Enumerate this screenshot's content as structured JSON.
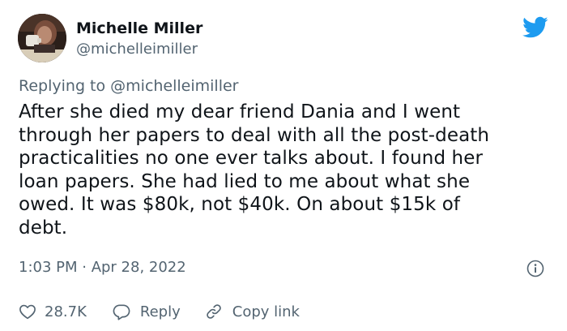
{
  "author": {
    "display_name": "Michelle Miller",
    "handle": "@michelleimiller"
  },
  "reply": {
    "prefix": "Replying to ",
    "mention": "@michelleimiller"
  },
  "tweet": {
    "lines": [
      "After she died my dear friend Dania and I went",
      "through her papers to deal with all the post-death",
      "practicalities no one ever talks about. I found her",
      "loan papers. She had lied to me about what she",
      "owed. It was $80k, not $40k. On about $15k of",
      "debt."
    ],
    "timestamp": "1:03 PM · Apr 28, 2022"
  },
  "actions": {
    "like_count": "28.7K",
    "reply_label": "Reply",
    "copy_link_label": "Copy link"
  },
  "colors": {
    "text": "#0f1419",
    "muted": "#536471",
    "brand": "#1d9bf0"
  },
  "icons": {
    "logo": "twitter-bird-icon",
    "info": "info-icon",
    "like": "heart-icon",
    "reply": "speech-bubble-icon",
    "copy": "link-icon"
  }
}
